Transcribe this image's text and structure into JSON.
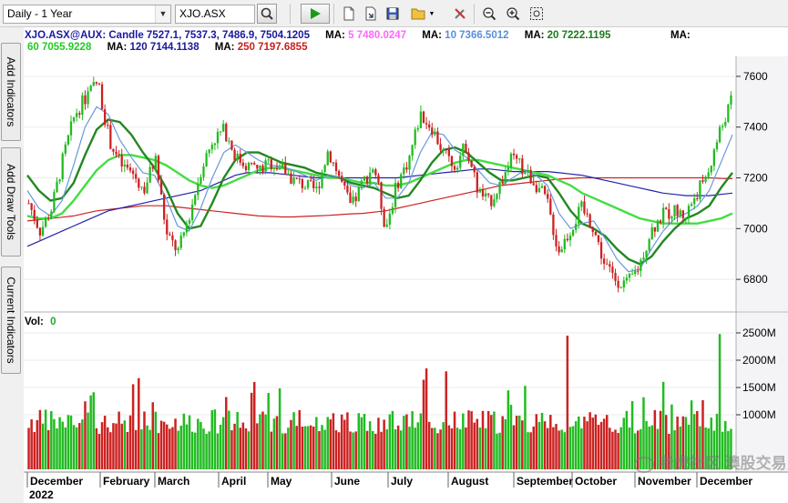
{
  "toolbar": {
    "period": "Daily - 1 Year",
    "symbol": "XJO.ASX"
  },
  "side_tabs": {
    "add_indicators": "Add Indicators",
    "add_draw_tools": "Add Draw Tools",
    "current_indicators": "Current Indicators"
  },
  "header": {
    "symbol_line": "XJO.ASX@AUX: Candle 7527.1, 7537.3, 7486.9, 7504.1205",
    "ma5_label": "MA:",
    "ma5_value": "5 7480.0247",
    "ma10_label": "MA:",
    "ma10_value": "10 7366.5012",
    "ma20_label": "MA:",
    "ma20_value": "20 7222.1195",
    "ma60_label": "MA:",
    "ma60_value": "60 7055.9228",
    "ma120_label": "MA:",
    "ma120_value": "120 7144.1138",
    "ma250_label": "MA:",
    "ma250_value": "250 7197.6855"
  },
  "volume_header": {
    "label": "Vol:",
    "value": "0"
  },
  "watermark": "老虎社区 澳股交易员",
  "colors": {
    "ma5": "#ff80ff",
    "ma10": "#6699dd",
    "ma20": "#228822",
    "ma60": "#44dd44",
    "ma120": "#2222aa",
    "ma250": "#cc2222",
    "up": "#22bb22",
    "down": "#cc2222"
  },
  "chart_data": {
    "type": "candlestick",
    "price_axis": {
      "ticks": [
        6800,
        7000,
        7200,
        7400,
        7600
      ],
      "range": [
        6700,
        7650
      ]
    },
    "volume_axis": {
      "ticks": [
        "1000M",
        "1500M",
        "2000M",
        "2500M"
      ],
      "range": [
        0,
        2600
      ]
    },
    "x_axis": {
      "months": [
        "December",
        "February",
        "March",
        "April",
        "May",
        "June",
        "July",
        "August",
        "September",
        "October",
        "November",
        "December"
      ],
      "year_label": "2022"
    },
    "series": [
      {
        "name": "Close",
        "key": "close",
        "values": [
          7100,
          6990,
          7080,
          7280,
          7450,
          7520,
          7580,
          7350,
          7250,
          7220,
          7150,
          7280,
          6970,
          6910,
          7060,
          7240,
          7350,
          7390,
          7280,
          7250,
          7230,
          7260,
          7240,
          7190,
          7170,
          7150,
          7310,
          7200,
          7080,
          7180,
          7250,
          7000,
          7180,
          7270,
          7450,
          7400,
          7300,
          7250,
          7330,
          7150,
          7100,
          7180,
          7280,
          7230,
          7180,
          7110,
          6910,
          6990,
          7080,
          7010,
          6860,
          6800,
          6780,
          6850,
          6990,
          7050,
          7070,
          7050,
          7140,
          7220,
          7380,
          7500
        ]
      },
      {
        "name": "MA 10",
        "key": "ma10",
        "values": [
          7150,
          7080,
          7050,
          7110,
          7250,
          7400,
          7480,
          7450,
          7350,
          7280,
          7220,
          7210,
          7120,
          7010,
          6990,
          7080,
          7200,
          7300,
          7330,
          7300,
          7270,
          7250,
          7245,
          7230,
          7210,
          7190,
          7210,
          7200,
          7170,
          7160,
          7180,
          7120,
          7120,
          7180,
          7300,
          7380,
          7370,
          7310,
          7280,
          7230,
          7180,
          7170,
          7200,
          7230,
          7210,
          7170,
          7060,
          7000,
          7020,
          7030,
          6960,
          6880,
          6830,
          6840,
          6920,
          6990,
          7040,
          7060,
          7090,
          7150,
          7260,
          7370
        ]
      },
      {
        "name": "MA 20",
        "key": "ma20",
        "values": [
          7210,
          7150,
          7110,
          7120,
          7180,
          7290,
          7390,
          7430,
          7420,
          7370,
          7300,
          7240,
          7160,
          7060,
          7000,
          7010,
          7100,
          7200,
          7270,
          7300,
          7300,
          7280,
          7260,
          7250,
          7240,
          7220,
          7210,
          7200,
          7180,
          7170,
          7160,
          7140,
          7120,
          7130,
          7190,
          7260,
          7310,
          7320,
          7300,
          7260,
          7220,
          7190,
          7190,
          7200,
          7210,
          7200,
          7140,
          7070,
          7020,
          7000,
          6970,
          6920,
          6880,
          6860,
          6890,
          6950,
          7000,
          7040,
          7060,
          7090,
          7160,
          7220
        ]
      },
      {
        "name": "MA 60",
        "key": "ma60",
        "values": [
          7050,
          7040,
          7040,
          7060,
          7110,
          7170,
          7230,
          7270,
          7290,
          7290,
          7280,
          7270,
          7250,
          7220,
          7190,
          7170,
          7160,
          7170,
          7190,
          7210,
          7230,
          7240,
          7240,
          7230,
          7220,
          7210,
          7200,
          7200,
          7190,
          7180,
          7180,
          7170,
          7170,
          7180,
          7200,
          7220,
          7240,
          7260,
          7270,
          7270,
          7260,
          7250,
          7240,
          7230,
          7220,
          7210,
          7190,
          7170,
          7140,
          7120,
          7100,
          7080,
          7060,
          7040,
          7030,
          7020,
          7020,
          7020,
          7020,
          7030,
          7040,
          7060
        ]
      },
      {
        "name": "MA 120",
        "key": "ma120",
        "values": [
          6930,
          6950,
          6970,
          6990,
          7010,
          7030,
          7050,
          7070,
          7080,
          7090,
          7100,
          7110,
          7120,
          7130,
          7140,
          7150,
          7170,
          7190,
          7210,
          7220,
          7220,
          7220,
          7215,
          7210,
          7205,
          7200,
          7200,
          7200,
          7200,
          7200,
          7200,
          7200,
          7200,
          7205,
          7210,
          7215,
          7220,
          7225,
          7230,
          7235,
          7235,
          7230,
          7225,
          7225,
          7225,
          7225,
          7220,
          7215,
          7210,
          7200,
          7190,
          7180,
          7170,
          7160,
          7150,
          7140,
          7135,
          7130,
          7130,
          7130,
          7135,
          7140
        ]
      },
      {
        "name": "MA 250",
        "key": "ma250",
        "values": [
          7030,
          7035,
          7040,
          7045,
          7050,
          7060,
          7070,
          7075,
          7080,
          7085,
          7090,
          7090,
          7090,
          7085,
          7080,
          7075,
          7070,
          7065,
          7060,
          7055,
          7050,
          7048,
          7046,
          7046,
          7048,
          7050,
          7052,
          7055,
          7058,
          7060,
          7065,
          7070,
          7080,
          7090,
          7100,
          7110,
          7120,
          7130,
          7140,
          7150,
          7160,
          7170,
          7175,
          7180,
          7185,
          7190,
          7195,
          7198,
          7200,
          7200,
          7200,
          7200,
          7200,
          7200,
          7200,
          7200,
          7200,
          7200,
          7200,
          7200,
          7198,
          7197
        ]
      }
    ]
  }
}
